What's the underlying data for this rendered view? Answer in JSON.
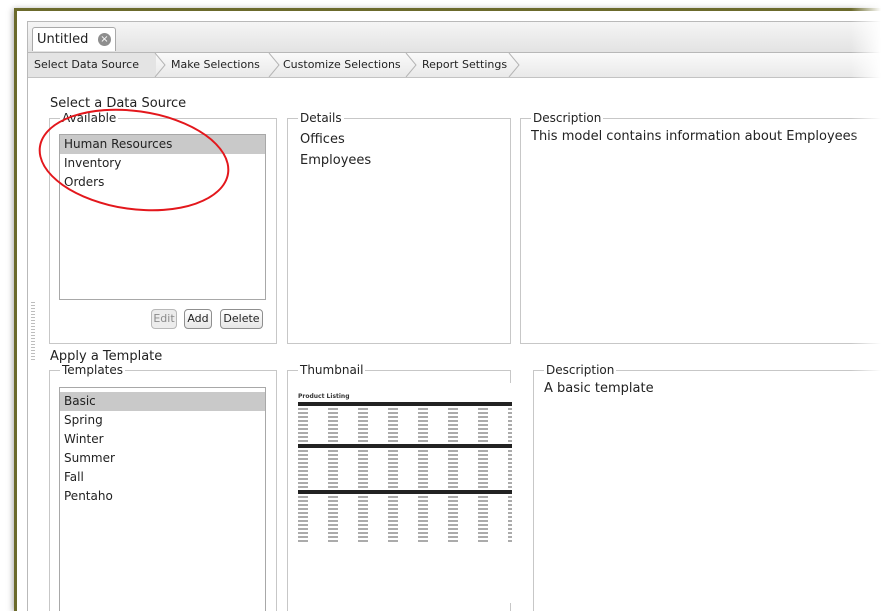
{
  "document_tab": {
    "title": "Untitled"
  },
  "wizard_steps": [
    {
      "label": "Select Data Source",
      "active": true
    },
    {
      "label": "Make Selections",
      "active": false
    },
    {
      "label": "Customize Selections",
      "active": false
    },
    {
      "label": "Report Settings",
      "active": false
    }
  ],
  "data_source": {
    "section_title": "Select a Data Source",
    "available": {
      "legend": "Available",
      "items": [
        "Human Resources",
        "Inventory",
        "Orders"
      ],
      "selected_index": 0,
      "buttons": {
        "edit": "Edit",
        "add": "Add",
        "delete": "Delete"
      }
    },
    "details": {
      "legend": "Details",
      "items": [
        "Offices",
        "Employees"
      ]
    },
    "description": {
      "legend": "Description",
      "text": "This model contains information about Employees"
    }
  },
  "template": {
    "section_title": "Apply a Template",
    "templates": {
      "legend": "Templates",
      "items": [
        "Basic",
        "Spring",
        "Winter",
        "Summer",
        "Fall",
        "Pentaho"
      ],
      "selected_index": 0
    },
    "thumbnail": {
      "legend": "Thumbnail",
      "title": "Product Listing"
    },
    "description": {
      "legend": "Description",
      "text": "A basic template"
    }
  },
  "colors": {
    "frame_border": "#6b6a2c",
    "annotation": "#e3171c",
    "selection": "#c9c9c9"
  },
  "icons": {
    "tab_close": "close-circle-icon"
  }
}
